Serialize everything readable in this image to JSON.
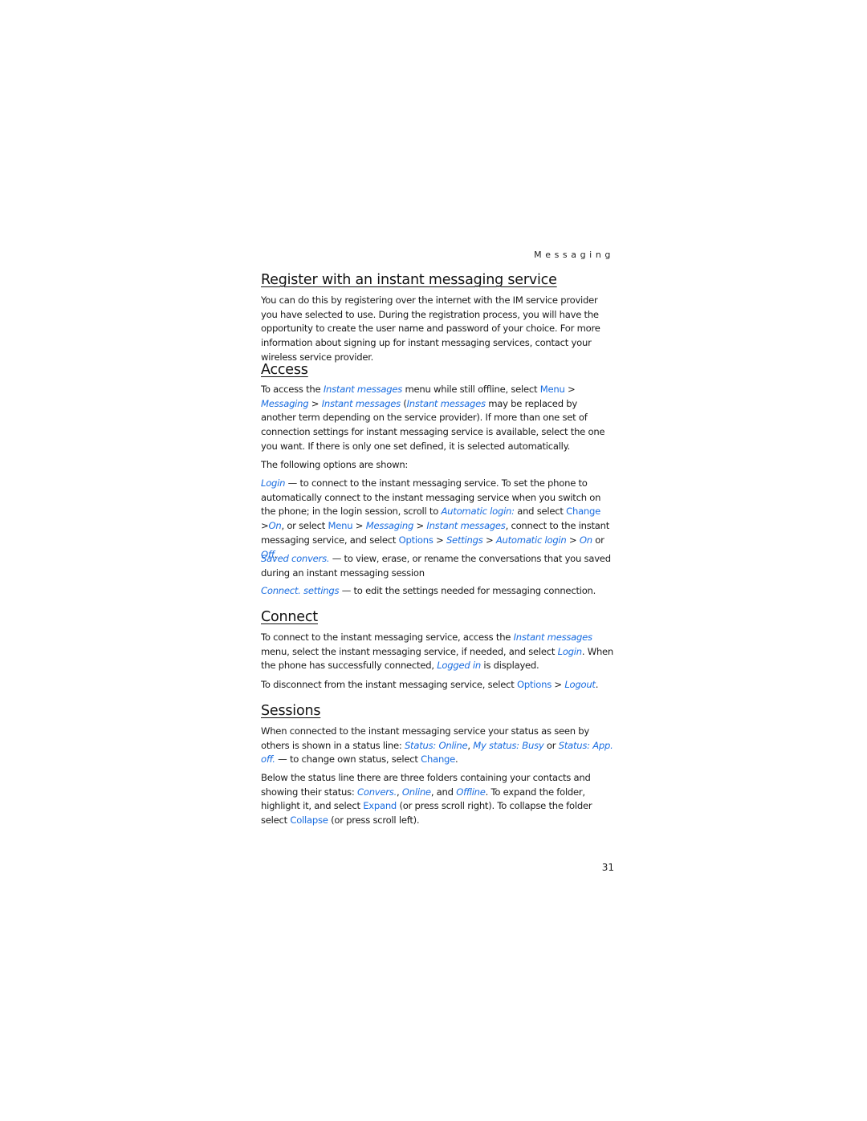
{
  "running_head": "Messaging",
  "page_number": "31",
  "link_color": "#1a6de0",
  "sections": {
    "register": {
      "title": "Register with an instant messaging service",
      "p1": "You can do this by registering over the internet with the IM service provider you have selected to use. During the registration process, you will have the opportunity to create the user name and password of your choice. For more information about signing up for instant messaging services, contact your wireless service provider."
    },
    "access": {
      "title": "Access",
      "p1": {
        "t1": "To access the ",
        "l1": "Instant messages",
        "t2": " menu while still offline, select ",
        "m1": "Menu",
        "t3": " > ",
        "l2": "Messaging",
        "t4": " > ",
        "l3": "Instant messages",
        "t5": " (",
        "l4": "Instant messages",
        "t6": " may be replaced by another term depending on the service provider). If more than one set of connection settings for instant messaging service is available, select the one you want. If there is only one set defined, it is selected automatically."
      },
      "p2": "The following options are shown:",
      "login": {
        "l1": "Login",
        "t1": " — to connect to the instant messaging service. To set the phone to automatically connect to the instant messaging service when you switch on the phone; in the login session, scroll to ",
        "l2": "Automatic login:",
        "t2": " and select ",
        "m1": "Change",
        "t3": " >",
        "l3": "On",
        "t4": ", or select ",
        "m2": "Menu",
        "t5": " > ",
        "l4": "Messaging",
        "t6": " > ",
        "l5": "Instant messages",
        "t7": ", connect to the instant messaging service, and select ",
        "m3": "Options",
        "t8": " > ",
        "l6": "Settings",
        "t9": " > ",
        "l7": "Automatic login",
        "t10": " > ",
        "l8": "On",
        "t11": " or ",
        "l9": "Off",
        "t12": "."
      },
      "saved": {
        "l1": "Saved convers.",
        "t1": " — to view, erase, or rename the conversations that you saved during an instant messaging session"
      },
      "connect_settings": {
        "l1": "Connect. settings",
        "t1": " — to edit the settings needed for messaging connection."
      }
    },
    "connect": {
      "title": "Connect",
      "p1": {
        "t1": "To connect to the instant messaging service, access the ",
        "l1": "Instant messages",
        "t2": " menu, select the instant messaging service, if needed, and select ",
        "l2": "Login",
        "t3": ". When the phone has successfully connected, ",
        "l3": "Logged in",
        "t4": " is displayed."
      },
      "p2": {
        "t1": "To disconnect from the instant messaging service, select ",
        "m1": "Options",
        "t2": " > ",
        "l1": "Logout",
        "t3": "."
      }
    },
    "sessions": {
      "title": "Sessions",
      "p1": {
        "t1": "When connected to the instant messaging service your status as seen by others is shown in a status line: ",
        "l1": "Status: Online",
        "t2": ", ",
        "l2": "My status: Busy",
        "t3": " or ",
        "l3": "Status: App. off.",
        "t4": " — to change own status, select ",
        "m1": "Change",
        "t5": "."
      },
      "p2": {
        "t1": "Below the status line there are three folders containing your contacts and showing their status: ",
        "l1": "Convers.",
        "t2": ", ",
        "l2": "Online",
        "t3": ", and ",
        "l3": "Offline",
        "t4": ". To expand the folder, highlight it, and select ",
        "m1": "Expand",
        "t5": " (or press scroll right). To collapse the folder select ",
        "m2": "Collapse",
        "t6": " (or press scroll left)."
      }
    }
  }
}
